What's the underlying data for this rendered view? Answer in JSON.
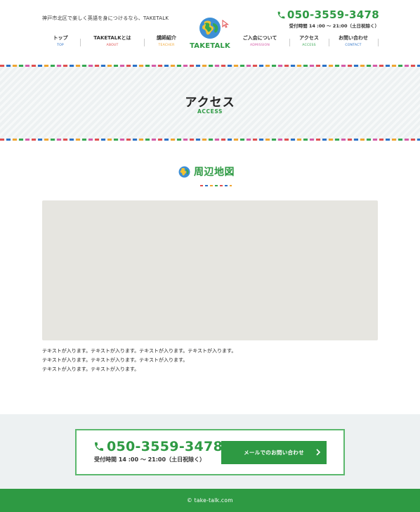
{
  "header": {
    "tagline": "神戸市北区で楽しく英語を身につけるなら、TAKETALK",
    "phone_number": "050-3559-3478",
    "phone_hours": "受付時間 14 :00 〜 21:00（土日祝除く）",
    "logo_text": "TAKETALK"
  },
  "nav": {
    "items": [
      {
        "ja": "トップ",
        "en": "TOP",
        "color": "#2b72c7"
      },
      {
        "ja": "TAKETALKとは",
        "en": "ABOUT",
        "color": "#e04f4f"
      },
      {
        "ja": "講師紹介",
        "en": "TEACHER",
        "color": "#f0a530"
      },
      {
        "ja": "ご入会について",
        "en": "ADMISSION",
        "color": "#d55ca8"
      },
      {
        "ja": "アクセス",
        "en": "ACCESS",
        "color": "#36a852"
      },
      {
        "ja": "お問い合わせ",
        "en": "CONTACT",
        "color": "#2b72c7"
      }
    ]
  },
  "hero": {
    "title": "アクセス",
    "subtitle": "ACCESS"
  },
  "section": {
    "title": "周辺地図"
  },
  "body": {
    "lines": [
      "テキストが入ります。テキストが入ります。テキストが入ります。テキストが入ります。",
      "テキストが入ります。テキストが入ります。テキストが入ります。",
      "テキストが入ります。テキストが入ります。"
    ]
  },
  "contact": {
    "phone_number": "050-3559-3478",
    "hours": "受付時間 14 :00 〜 21:00（土日祝除く）",
    "mail_button": "メールでのお問い合わせ"
  },
  "footer": {
    "copyright": "© take-talk.com"
  },
  "colors": {
    "brand_green": "#2e9a43",
    "hero_bg": "#edf1f2",
    "map_bg": "#e6e5e0"
  }
}
